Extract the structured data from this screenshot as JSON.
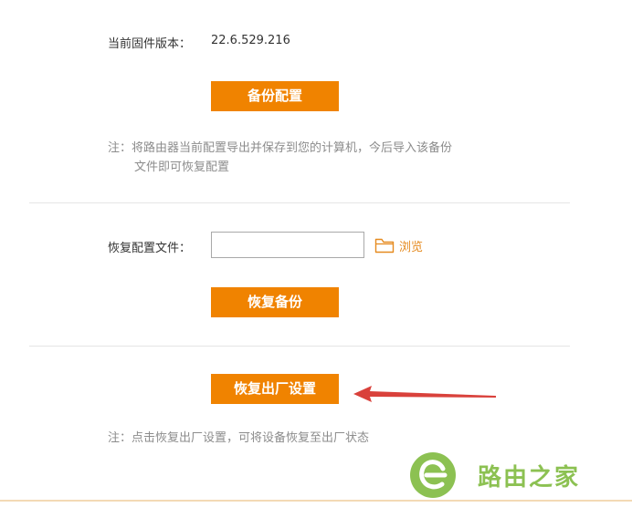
{
  "firmware": {
    "label": "当前固件版本：",
    "value": "22.6.529.216"
  },
  "backup": {
    "button_label": "备份配置",
    "note_line1": "注：将路由器当前配置导出并保存到您的计算机，今后导入该备份",
    "note_line2": "文件即可恢复配置"
  },
  "restore": {
    "file_label": "恢复配置文件：",
    "file_value": "",
    "browse_label": "浏览",
    "button_label": "恢复备份"
  },
  "factory_reset": {
    "button_label": "恢复出厂设置",
    "note": "注：点击恢复出厂设置，可将设备恢复至出厂状态"
  },
  "watermark": {
    "text": "路由之家"
  },
  "colors": {
    "accent": "#f08300",
    "arrow": "#d9413b",
    "watermark_green": "#8cc152"
  },
  "icons": {
    "browse": "folder-icon",
    "annotation": "red-arrow-icon",
    "watermark_logo": "e-logo-icon"
  }
}
